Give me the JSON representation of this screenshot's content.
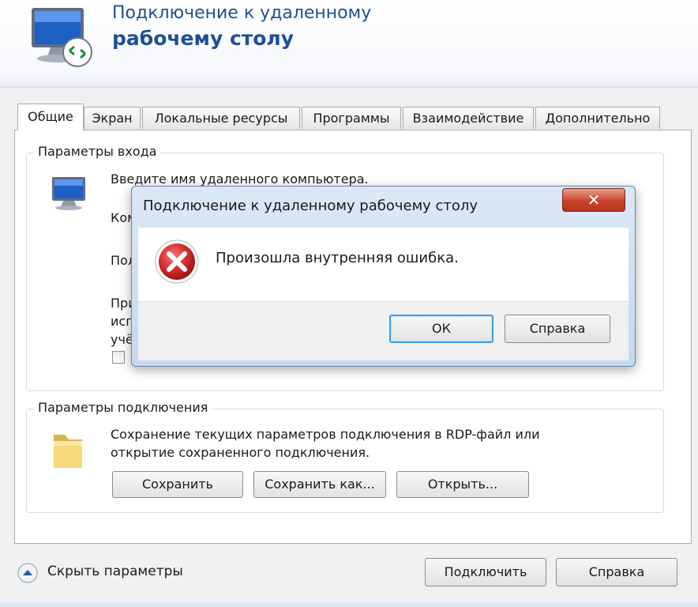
{
  "header": {
    "title_line1": "Подключение к удаленному",
    "title_line2": "рабочему столу"
  },
  "tabs": [
    {
      "label": "Общие",
      "active": true
    },
    {
      "label": "Экран"
    },
    {
      "label": "Локальные ресурсы"
    },
    {
      "label": "Программы"
    },
    {
      "label": "Взаимодействие"
    },
    {
      "label": "Дополнительно"
    }
  ],
  "login_group": {
    "title": "Параметры входа",
    "prompt": "Введите имя удаленного компьютера.",
    "computer_label_partial": "Ком",
    "user_label_partial": "Пол",
    "note_line1_partial": "При",
    "note_line2_partial": "исп",
    "note_line3_partial": "учё"
  },
  "connection_group": {
    "title": "Параметры подключения",
    "desc_line1": "Сохранение текущих параметров подключения в RDP-файл или",
    "desc_line2": "открытие сохраненного подключения.",
    "save": "Сохранить",
    "save_as": "Сохранить как...",
    "open": "Открыть..."
  },
  "dialog": {
    "title": "Подключение к удаленному рабочему столу",
    "close_glyph": "✕",
    "message": "Произошла внутренняя ошибка.",
    "ok": "ОК",
    "help": "Справка"
  },
  "footer": {
    "hide_options": "Скрыть параметры",
    "connect": "Подключить",
    "help": "Справка"
  },
  "colors": {
    "title_blue": "#1e4f95",
    "error_red": "#d62b2b",
    "focus_blue": "#3c9fe0"
  }
}
